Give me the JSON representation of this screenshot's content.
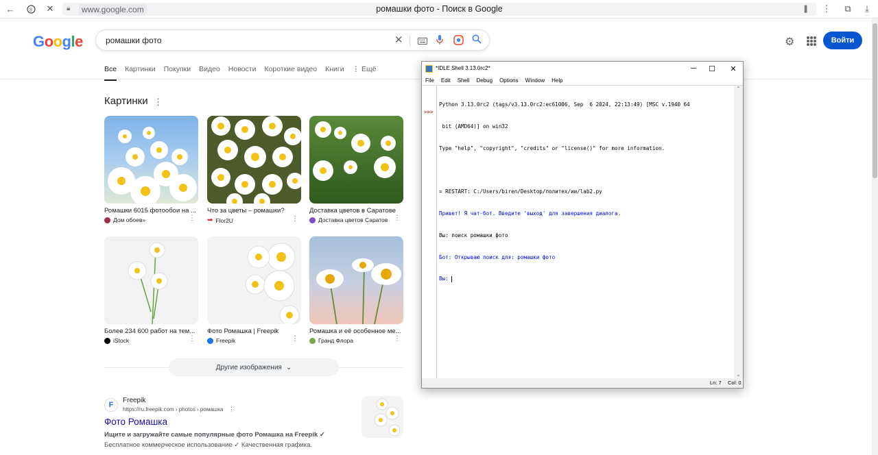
{
  "browser": {
    "url": "www.google.com",
    "page_title": "ромашки фото - Поиск в Google"
  },
  "google": {
    "logo": "Google",
    "query": "ромашки фото",
    "signin": "Войти",
    "tabs": [
      {
        "label": "Все",
        "active": true
      },
      {
        "label": "Картинки"
      },
      {
        "label": "Покупки"
      },
      {
        "label": "Видео"
      },
      {
        "label": "Новости"
      },
      {
        "label": "Короткие видео"
      },
      {
        "label": "Книги"
      },
      {
        "label": "⋮ Ещё"
      }
    ],
    "images_section_title": "Картинки",
    "images": [
      {
        "caption": "Ромашки 6015 фотообои на ...",
        "source": "Дом обоев»",
        "fav_color": "#a0304a"
      },
      {
        "caption": "Что за цветы – ромашки?",
        "source": "Flor2U",
        "fav_color": "#e03030"
      },
      {
        "caption": "Доставка цветов в Саратове",
        "source": "Доставка цветов Саратов",
        "fav_color": "#7a4fc9"
      },
      {
        "caption": "Более 234 600 работ на тем...",
        "source": "iStock",
        "fav_color": "#000000"
      },
      {
        "caption": "Фото Ромашка | Freepik",
        "source": "Freepik",
        "fav_color": "#1a73e8"
      },
      {
        "caption": "Ромашка и её особенное ме...",
        "source": "Гранд Флора",
        "fav_color": "#7aa84a"
      }
    ],
    "more_images": "Другие изображения",
    "result": {
      "site": "Freepik",
      "url": "https://ru.freepik.com › photos › ромашка",
      "title": "Фото Ромашка",
      "snippet1": "Ищите и загружайте самые популярные фото Ромашка на Freepik ✓",
      "snippet2": "Бесплатное коммерческое использование ✓ Качественная графика."
    }
  },
  "idle": {
    "title": "*IDLE Shell 3.13.0rc2*",
    "menu": [
      "File",
      "Edit",
      "Shell",
      "Debug",
      "Options",
      "Window",
      "Help"
    ],
    "prompt": ">>>",
    "lines": {
      "l1": "Python 3.13.0rc2 (tags/v3.13.0rc2:ec61006, Sep  6 2024, 22:13:49) [MSC v.1940 64",
      "l2": " bit (AMD64)] on win32",
      "l3": "Type \"help\", \"copyright\", \"credits\" or \"license()\" for more information.",
      "l4": "= RESTART: C:/Users/biren/Desktop/политех/ии/lab2.py",
      "l5": "Привет! Я чат-бот. Введите 'выход' для завершения диалога.",
      "l6": "Вы: поиск ромашки фото",
      "l7": "Бот: Открываю поиск для: ромашки фото",
      "l8": "Вы: "
    },
    "status": {
      "ln": "Ln: 7",
      "col": "Col: 0"
    }
  }
}
